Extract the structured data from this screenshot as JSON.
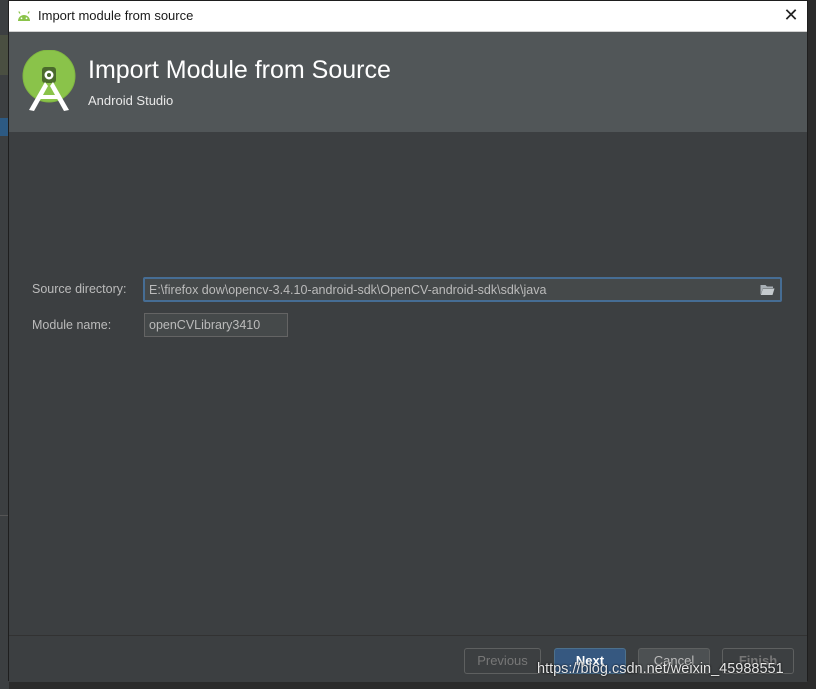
{
  "window": {
    "title": "Import module from source",
    "close_glyph": "✕",
    "app_icon": "android-icon"
  },
  "header": {
    "title": "Import Module from Source",
    "subtitle": "Android Studio",
    "logo": "android-studio-logo",
    "accent_color": "#8ac34a"
  },
  "form": {
    "source_label": "Source directory:",
    "source_value": "E:\\firefox dow\\opencv-3.4.10-android-sdk\\OpenCV-android-sdk\\sdk\\java",
    "module_label": "Module name:",
    "module_value": "openCVLibrary3410",
    "folder_icon": "folder-open-icon"
  },
  "buttons": {
    "previous": "Previous",
    "next": "Next",
    "cancel": "Cancel",
    "finish": "Finish"
  },
  "watermark": "https://blog.csdn.net/weixin_45988551"
}
